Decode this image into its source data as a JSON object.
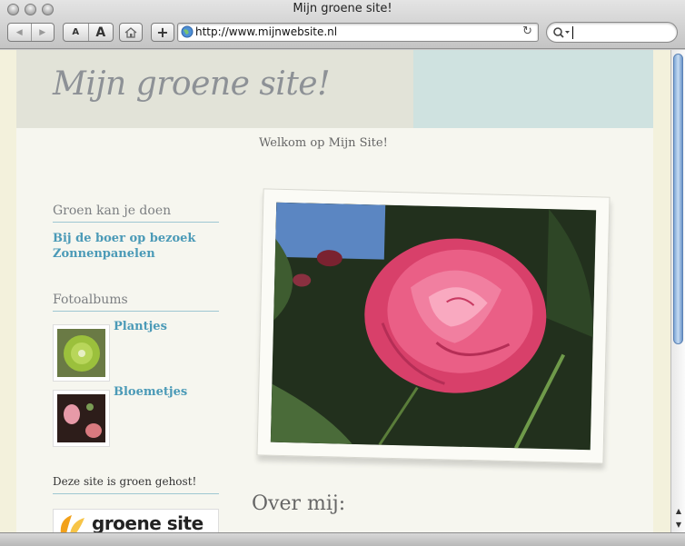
{
  "window": {
    "title": "Mijn groene site!"
  },
  "toolbar": {
    "back_glyph": "◀",
    "forward_glyph": "▶",
    "text_smaller": "A",
    "text_bigger": "A",
    "add_glyph": "+",
    "url": "http://www.mijnwebsite.nl",
    "reload_glyph": "↻",
    "search_value": ""
  },
  "site": {
    "title": "Mijn groene site!",
    "welcome": "Welkom op Mijn Site!",
    "sidebar": {
      "section1_heading": "Groen kan je doen",
      "links": [
        "Bij de boer op bezoek",
        "Zonnenpanelen"
      ],
      "section2_heading": "Fotoalbums",
      "albums": [
        "Plantjes",
        "Bloemetjes"
      ],
      "hosted_text": "Deze site is groen gehost!",
      "logo_text": "groene site"
    },
    "main": {
      "about_heading": "Over mij:"
    }
  },
  "colors": {
    "header_right": "#cfe2e0",
    "link": "#4b9ab7",
    "rose": "#e8507a"
  }
}
